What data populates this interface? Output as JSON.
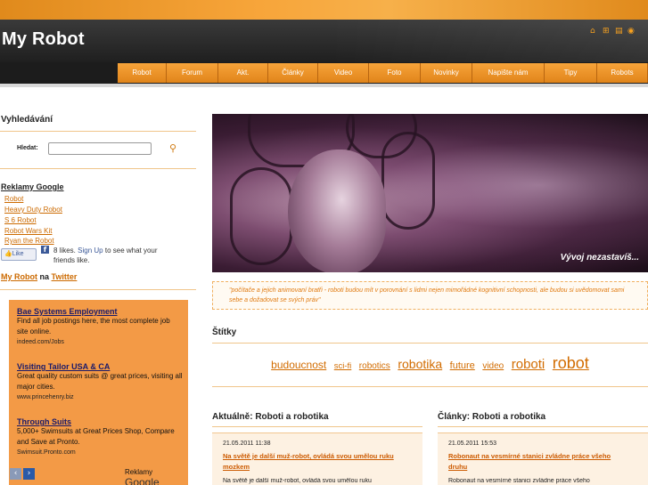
{
  "header": {
    "site_title": "My Robot",
    "icons": [
      "home-icon",
      "sitemap-icon",
      "print-icon",
      "rss-icon"
    ]
  },
  "nav": {
    "items": [
      "Robot",
      "Forum",
      "Akt.",
      "Články",
      "Video",
      "Foto",
      "Novinky",
      "Napište nám",
      "Tipy",
      "Robots"
    ]
  },
  "sidebar": {
    "search_heading": "Vyhledávání",
    "search_label": "Hledat:",
    "search_value": "",
    "ads_heading": "Reklamy Google",
    "ad_links": [
      "Robot",
      "Heavy Duty Robot",
      "S 6 Robot",
      "Robot Wars Kit",
      "Ryan the Robot"
    ],
    "fb_like": "Like",
    "fb_text_before": "8 likes.",
    "fb_signup": "Sign Up",
    "fb_text_after": "to see what your friends like.",
    "twitter_site": "My Robot",
    "twitter_mid": "na",
    "twitter_link": "Twitter"
  },
  "adbox": {
    "ads": [
      {
        "title": "Bae Systems Employment",
        "desc": "Find all job postings here, the most complete job site online.",
        "url": "indeed.com/Jobs"
      },
      {
        "title": "Visiting Tailor USA & CA",
        "desc": "Great quality custom suits @ great prices, visiting all major cities.",
        "url": "www.princehenry.biz"
      },
      {
        "title": "Through Suits",
        "desc": "5,000+ Swimsuits at Great Prices Shop, Compare and Save at Pronto.",
        "url": "Swimsuit.Pronto.com"
      }
    ],
    "label_prefix": "Reklamy",
    "label_brand": "Google"
  },
  "main": {
    "banner_caption": "Vývoj nezastavíš...",
    "quote": "\"počítače a jejich animovaní bratři - roboti budou mít v porovnání s lidmi nejen mimořádné kognitivní schopnosti, ale budou si uvědomovat sami sebe a dožadovat se svých práv\"",
    "tags_heading": "Štítky",
    "tags": [
      {
        "label": "budoucnost",
        "size": 1
      },
      {
        "label": "sci-fi",
        "size": 0
      },
      {
        "label": "robotics",
        "size": 0
      },
      {
        "label": "robotika",
        "size": 2
      },
      {
        "label": "future",
        "size": 1
      },
      {
        "label": "video",
        "size": 0
      },
      {
        "label": "roboti",
        "size": 2
      },
      {
        "label": "robot",
        "size": 3
      }
    ],
    "news_left": {
      "heading": "Aktuálně: Roboti a robotika",
      "date": "21.05.2011 11:38",
      "title": "Na světě je další muž-robot, ovládá svou umělou ruku mozkem",
      "text": "Na světě je další muž-robot, ovládá svou umělou ruku"
    },
    "news_right": {
      "heading": "Články: Roboti a robotika",
      "date": "21.05.2011 15:53",
      "title": "Robonaut na vesmírné stanici zvládne práce všeho druhu",
      "text": "Robonaut na vesmírné stanici zvládne práce všeho"
    }
  },
  "colors": {
    "accent": "#f39a30",
    "link": "#cc6a00",
    "header_bg": "#2a2a2a"
  }
}
